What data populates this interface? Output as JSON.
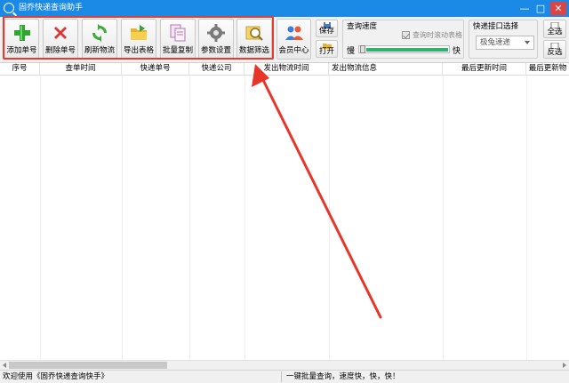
{
  "window": {
    "title": "固乔快递查询助手",
    "controls": {
      "minimize": "—",
      "maximize": "□",
      "close": "✕"
    }
  },
  "toolbar": {
    "buttons": [
      {
        "label": "添加单号",
        "icon": "plus-icon"
      },
      {
        "label": "删除单号",
        "icon": "x-icon"
      },
      {
        "label": "刷新物流",
        "icon": "refresh-icon"
      },
      {
        "label": "导出表格",
        "icon": "export-folder-icon"
      },
      {
        "label": "批量复制",
        "icon": "copy-icon"
      },
      {
        "label": "参数设置",
        "icon": "gear-icon"
      },
      {
        "label": "数据筛选",
        "icon": "filter-icon"
      },
      {
        "label": "会员中心",
        "icon": "users-icon"
      }
    ],
    "save_label": "保存",
    "open_label": "打开",
    "speed": {
      "title": "查询速度",
      "scroll_option": "查询时滚动表格",
      "slow_label": "慢",
      "fast_label": "快"
    },
    "api": {
      "title": "快递接口选择",
      "selected": "极兔速递"
    },
    "select_all_label": "全选",
    "invert_label": "反选"
  },
  "table": {
    "columns": [
      "序号",
      "查单时间",
      "快递单号",
      "快递公司",
      "发出物流时间",
      "发出物流信息",
      "最后更新时间",
      "最后更新物"
    ]
  },
  "status": {
    "left": "欢迎使用《固乔快递查询快手》",
    "right": "一键批量查询，速度快，快，快！"
  },
  "colors": {
    "titlebar": "#1a8ae6",
    "highlight_box": "#e83a2e",
    "annotation_arrow": "#e8352a"
  }
}
